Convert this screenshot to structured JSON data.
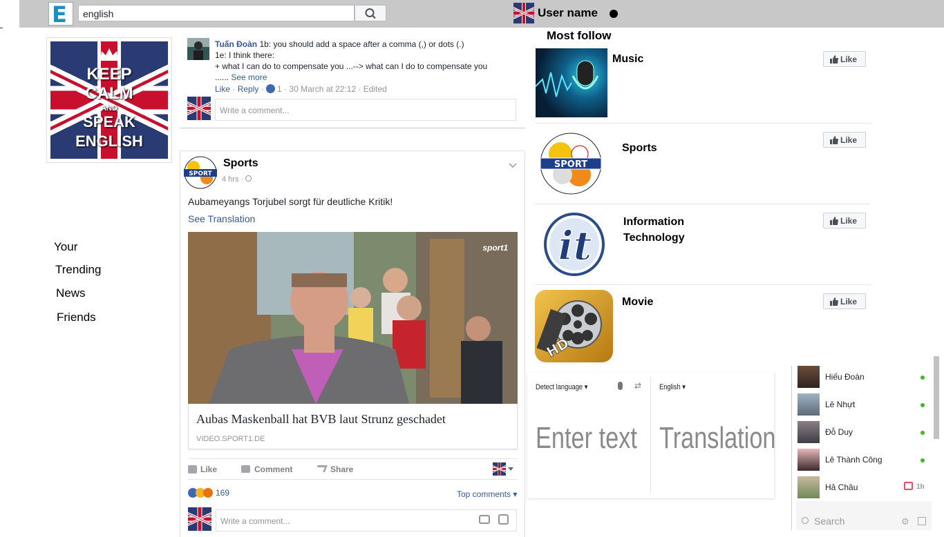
{
  "header": {
    "logo_letter": "E",
    "search_value": "english",
    "user_name": "User name"
  },
  "keep_calm": {
    "line1": "KEEP",
    "line2": "CALM",
    "line3": "AND",
    "line4": "SPEAK",
    "line5": "ENGLISH"
  },
  "left_nav": [
    "Your",
    "Trending",
    "News",
    "Friends"
  ],
  "comment_thread": {
    "author": "Tuấn Đoàn",
    "line1": " 1b: you should add a space after a comma (,) or dots (.)",
    "line2": "1e: I think there:",
    "line3": "+ what I can do to compensate you ...--> what can I do to compensate you",
    "line4_prefix": "...... ",
    "see_more": "See more",
    "like": "Like",
    "sep1": " · ",
    "reply": "Reply",
    "sep2": " · ",
    "reaction_count": "1",
    "meta": " · 30 March at 22:12 · Edited",
    "write_placeholder": "Write a comment..."
  },
  "post": {
    "page_name": "Sports",
    "time": "4 hrs · ",
    "text": "Aubameyangs Torjubel sorgt für deutliche Kritik!",
    "see_translation": "See Translation",
    "video_logo": "sport1",
    "link_title": "Aubas Maskenball hat BVB laut Strunz geschadet",
    "link_domain": "VIDEO.SPORT1.DE",
    "actions": {
      "like": "Like",
      "comment": "Comment",
      "share": "Share"
    },
    "reactions_count": "169",
    "top_comments": "Top comments",
    "write_placeholder": "Write a comment..."
  },
  "most_follow": {
    "title": "Most follow",
    "like_label": "Like",
    "pages": [
      {
        "name": "Music"
      },
      {
        "name": "Sports"
      },
      {
        "name": "Information",
        "name2": "Technology"
      },
      {
        "name": "Movie"
      }
    ],
    "sport_logo_text": "SPORT",
    "it_logo_text": "it",
    "hd_text": "HD"
  },
  "translate": {
    "source_lang": "Detect language",
    "target_lang": "English",
    "input_placeholder": "Enter text",
    "output_placeholder": "Translation"
  },
  "chat": {
    "contacts": [
      {
        "name": "Hiếu Đoàn",
        "online": true
      },
      {
        "name": "Lê Nhựt",
        "online": true
      },
      {
        "name": "Đỗ Duy",
        "online": true
      },
      {
        "name": "Lê Thành Công",
        "online": true
      },
      {
        "name": "Hả Châu",
        "online": false,
        "last_seen": "1h"
      }
    ],
    "search_placeholder": "Search"
  },
  "colors": {
    "topbar": "#c8c8c8",
    "link": "#365899",
    "online": "#42b72a",
    "like_blue": "#4267b2"
  }
}
